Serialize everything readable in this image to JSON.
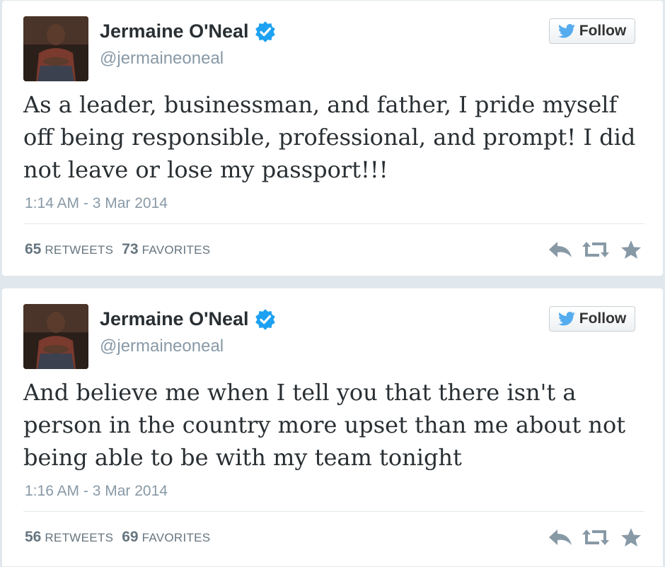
{
  "colors": {
    "name": "#292f33",
    "muted": "#8899a6",
    "verified": "#1da1f2",
    "twitter_bird": "#55acee",
    "action_icons": "#8899a6"
  },
  "tweets": [
    {
      "name": "Jermaine O'Neal",
      "handle": "@jermaineoneal",
      "follow_label": "Follow",
      "text": "As a leader, businessman, and father, I pride myself off being responsible, professional, and prompt! I did not leave or lose my passport!!!",
      "timestamp": "1:14 AM - 3 Mar 2014",
      "retweets": "65",
      "retweets_label": "RETWEETS",
      "favorites": "73",
      "favorites_label": "FAVORITES",
      "icons": [
        "verified-badge-icon",
        "twitter-bird-icon",
        "reply-icon",
        "retweet-icon",
        "favorite-star-icon"
      ]
    },
    {
      "name": "Jermaine O'Neal",
      "handle": "@jermaineoneal",
      "follow_label": "Follow",
      "text": "And believe me when I tell you that there isn't a person in the country more upset than me about not being able to be with my team tonight",
      "timestamp": "1:16 AM - 3 Mar 2014",
      "retweets": "56",
      "retweets_label": "RETWEETS",
      "favorites": "69",
      "favorites_label": "FAVORITES",
      "icons": [
        "verified-badge-icon",
        "twitter-bird-icon",
        "reply-icon",
        "retweet-icon",
        "favorite-star-icon"
      ]
    }
  ]
}
